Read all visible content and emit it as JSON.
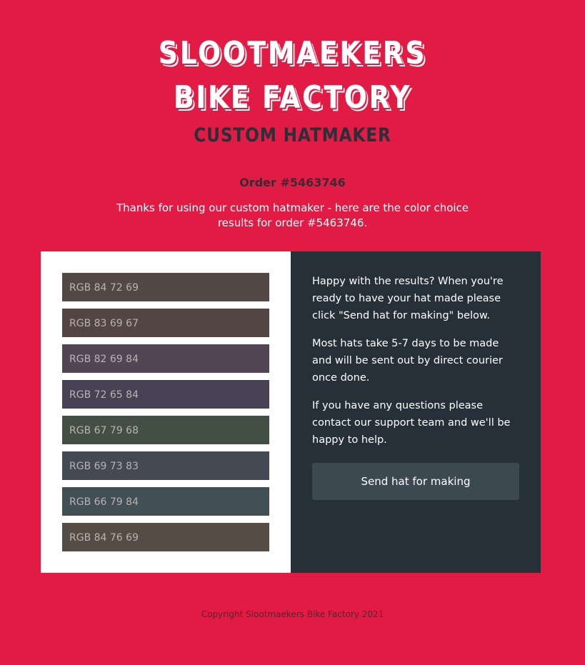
{
  "brand": {
    "line1": "SLOOTMAEKERS",
    "line2": "BIKE FACTORY",
    "subtitle": "CUSTOM HATMAKER"
  },
  "order": {
    "title": "Order #5463746",
    "intro": "Thanks for using our custom hatmaker - here are the color choice results for order #5463746."
  },
  "swatches": [
    {
      "label": "RGB 84 72 69",
      "color": "#544845"
    },
    {
      "label": "RGB 83 69 67",
      "color": "#534543"
    },
    {
      "label": "RGB 82 69 84",
      "color": "#524554"
    },
    {
      "label": "RGB 72 65 84",
      "color": "#484154"
    },
    {
      "label": "RGB 67 79 68",
      "color": "#434f44"
    },
    {
      "label": "RGB 69 73 83",
      "color": "#454953"
    },
    {
      "label": "RGB 66 79 84",
      "color": "#424f54"
    },
    {
      "label": "RGB 84 76 69",
      "color": "#544c45"
    }
  ],
  "info": {
    "p1": "Happy with the results? When you're ready to have your hat made please click \"Send hat for making\" below.",
    "p2": "Most hats take 5-7 days to be made and will be sent out by direct courier once done.",
    "p3": "If you have any questions please contact our support team and we'll be happy to help.",
    "button_label": "Send hat for making"
  },
  "footer": {
    "copyright": "Copyright Slootmaekers Bike Factory 2021"
  },
  "colors": {
    "background": "#e21b44",
    "panel_dark": "#263038",
    "button": "#3d4951"
  }
}
